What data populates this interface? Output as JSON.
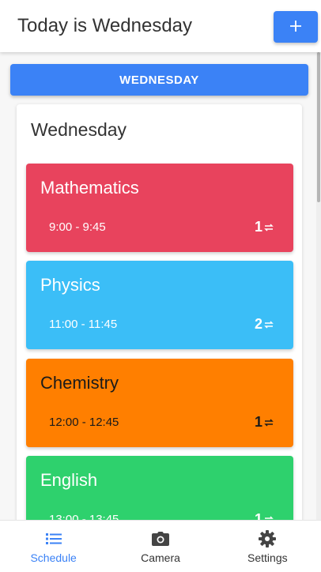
{
  "header": {
    "title": "Today is Wednesday",
    "add_icon": "plus-icon"
  },
  "day_selector": {
    "label": "WEDNESDAY"
  },
  "schedule": {
    "day_title": "Wednesday",
    "lessons": [
      {
        "name": "Mathematics",
        "time": "9:00 - 9:45",
        "count": "1",
        "color": "#e8435d",
        "text_color": "#ffffff"
      },
      {
        "name": "Physics",
        "time": "11:00 - 11:45",
        "count": "2",
        "color": "#3bbef7",
        "text_color": "#ffffff"
      },
      {
        "name": "Chemistry",
        "time": "12:00 - 12:45",
        "count": "1",
        "color": "#ff7f00",
        "text_color": "#1a1a1a"
      },
      {
        "name": "English",
        "time": "13:00 - 13:45",
        "count": "1",
        "color": "#2ed16d",
        "text_color": "#ffffff"
      }
    ]
  },
  "bottom_nav": {
    "items": [
      {
        "label": "Schedule",
        "icon": "list-icon",
        "active": true
      },
      {
        "label": "Camera",
        "icon": "camera-icon",
        "active": false
      },
      {
        "label": "Settings",
        "icon": "gear-icon",
        "active": false
      }
    ]
  },
  "colors": {
    "accent": "#3b82f6"
  }
}
